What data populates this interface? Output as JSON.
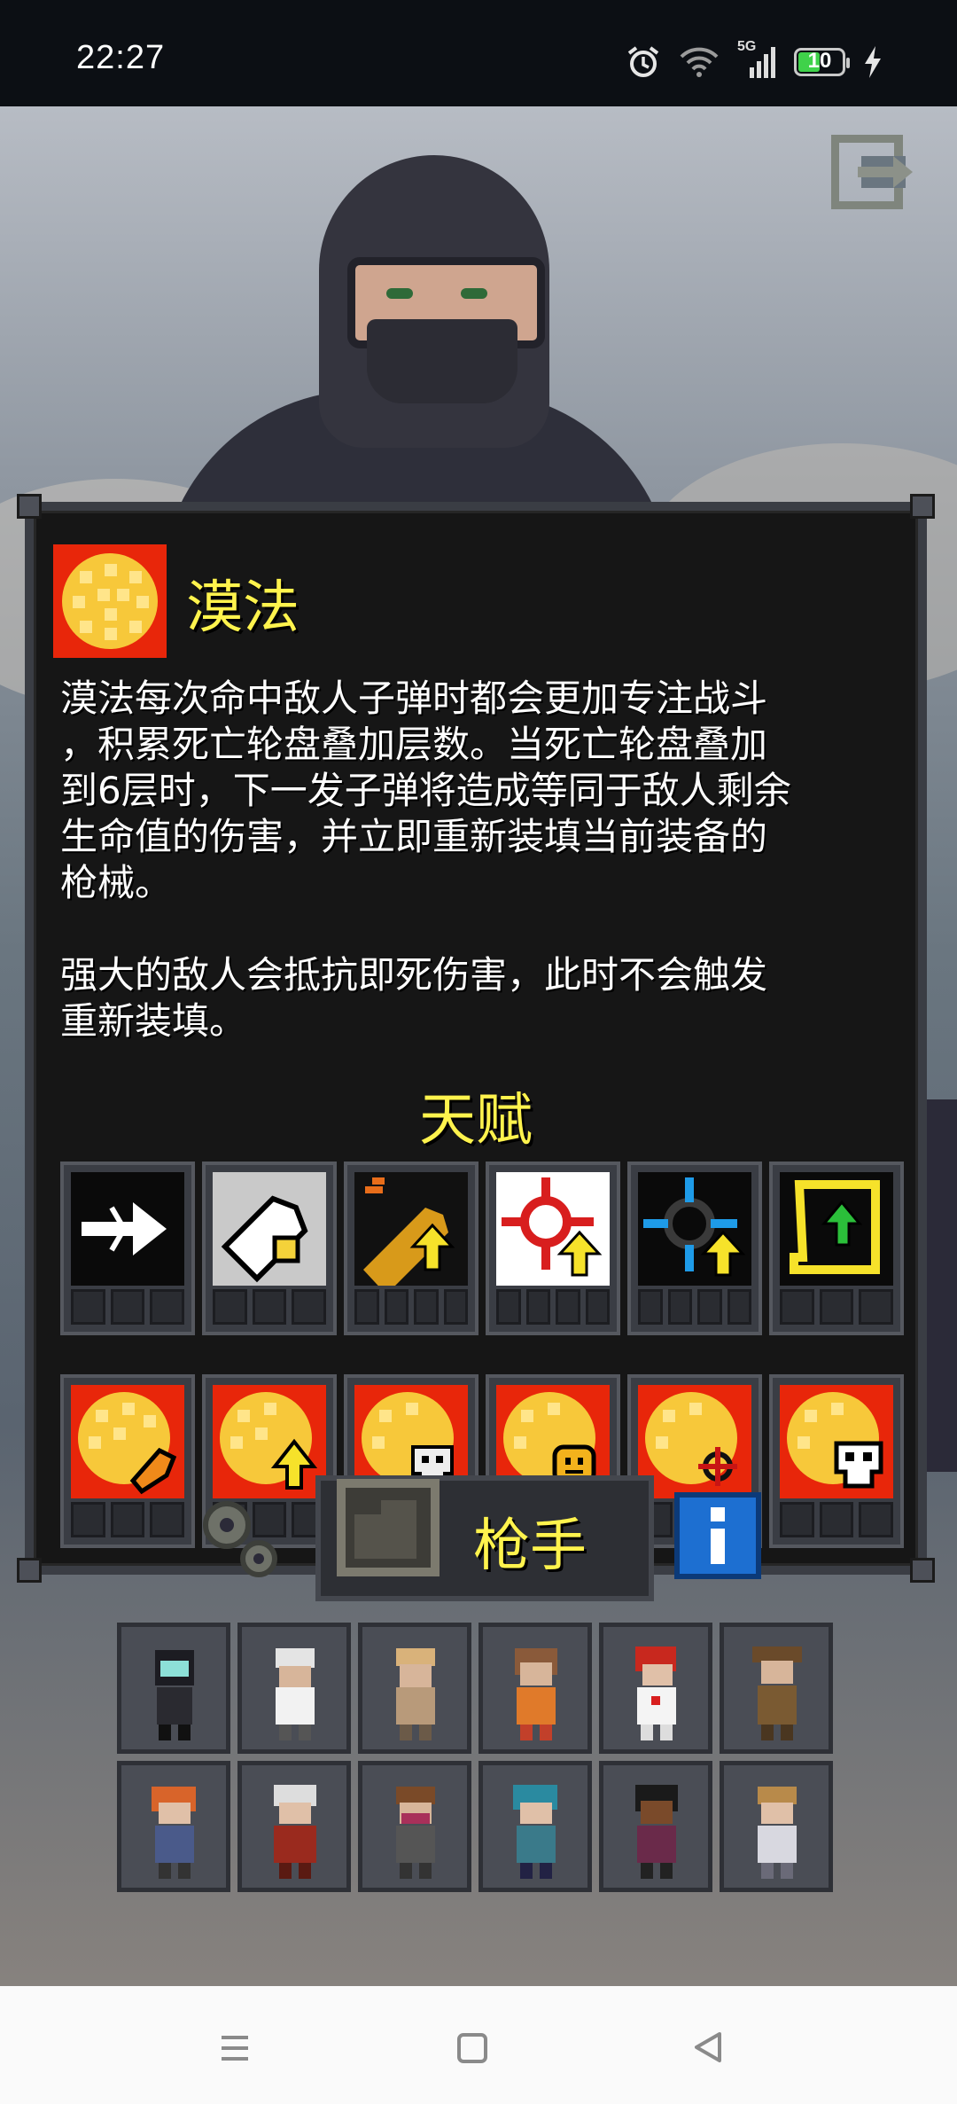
{
  "status_bar": {
    "time": "22:27",
    "network": "5G",
    "battery": "10",
    "icons": [
      "alarm-icon",
      "wifi-icon",
      "signal-icon",
      "battery-icon",
      "charging-icon"
    ]
  },
  "skill": {
    "name": "漠法",
    "description": "漠法每次命中敌人子弹时都会更加专注战斗\n，积累死亡轮盘叠加层数。当死亡轮盘叠加\n到6层时，下一发子弹将造成等同于敌人剩余\n生命值的伤害，并立即重新装填当前装备的\n枪械。\n\n强大的敌人会抵抗即死伤害，此时不会触发\n重新装填。",
    "icon": "death-wheel-icon"
  },
  "talents": {
    "title": "天赋",
    "row1": [
      "arrow-right-icon",
      "bullet-swap-icon",
      "bullet-upgrade-icon",
      "crosshair-red-upgrade-icon",
      "crosshair-blue-upgrade-icon",
      "scroll-upgrade-icon"
    ],
    "row2": [
      "wheel-bullet-icon",
      "wheel-arrow-icon",
      "wheel-skull-icon",
      "wheel-face-icon",
      "wheel-target-icon",
      "wheel-skull-white-icon"
    ]
  },
  "class_selector": {
    "name": "枪手",
    "info_icon": "info-icon",
    "settings_icon": "gear-icon"
  },
  "characters": [
    "gunner-masked",
    "white-hair-elder",
    "blonde-brawler",
    "brunette-fighter",
    "red-hair-medic",
    "bear-scout",
    "orange-hair-rogue",
    "white-hair-mage",
    "brown-hair-bandit",
    "teal-hair-hunter",
    "dark-skin-warrior",
    "blonde-knight"
  ],
  "colors": {
    "accent_yellow": "#fff34d",
    "panel_bg": "#161616",
    "panel_border": "#3a3d44",
    "info_blue": "#1d6fd1",
    "wheel_red": "#e8260a",
    "wheel_yellow": "#f7d24a"
  }
}
